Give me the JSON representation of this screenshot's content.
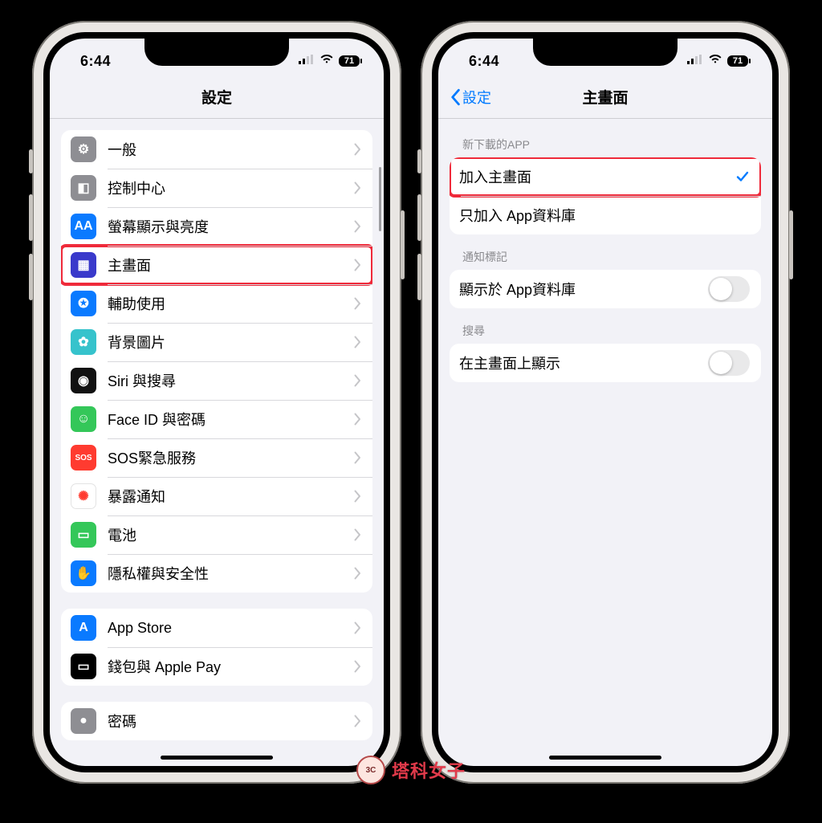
{
  "status": {
    "time": "6:44",
    "battery": "71"
  },
  "left": {
    "title": "設定",
    "group1": [
      {
        "label": "一般",
        "icon_bg": "#8e8e93",
        "glyph": "⚙"
      },
      {
        "label": "控制中心",
        "icon_bg": "#8e8e93",
        "glyph": "◧"
      },
      {
        "label": "螢幕顯示與亮度",
        "icon_bg": "#0a7aff",
        "glyph": "AA"
      },
      {
        "label": "主畫面",
        "icon_bg": "#3a3acb",
        "glyph": "▦",
        "highlight": true
      },
      {
        "label": "輔助使用",
        "icon_bg": "#0a7aff",
        "glyph": "✪"
      },
      {
        "label": "背景圖片",
        "icon_bg": "#36c3cc",
        "glyph": "✿"
      },
      {
        "label": "Siri 與搜尋",
        "icon_bg": "#111",
        "glyph": "◉"
      },
      {
        "label": "Face ID 與密碼",
        "icon_bg": "#34c759",
        "glyph": "☺"
      },
      {
        "label": "SOS緊急服務",
        "icon_bg": "#ff3b30",
        "glyph": "SOS"
      },
      {
        "label": "暴露通知",
        "icon_bg": "#ffffff",
        "glyph": "✺",
        "glyph_color": "#ff3b30",
        "border": true
      },
      {
        "label": "電池",
        "icon_bg": "#34c759",
        "glyph": "▭"
      },
      {
        "label": "隱私權與安全性",
        "icon_bg": "#0a7aff",
        "glyph": "✋"
      }
    ],
    "group2": [
      {
        "label": "App Store",
        "icon_bg": "#0a7aff",
        "glyph": "A"
      },
      {
        "label": "錢包與 Apple Pay",
        "icon_bg": "#000",
        "glyph": "▭"
      }
    ],
    "group3": [
      {
        "label": "密碼",
        "icon_bg": "#8e8e93",
        "glyph": "●"
      }
    ]
  },
  "right": {
    "back": "設定",
    "title": "主畫面",
    "sections": {
      "new_app_header": "新下載的APP",
      "add_home": "加入主畫面",
      "app_library_only": "只加入 App資料庫",
      "badge_header": "通知標記",
      "show_in_library": "顯示於 App資料庫",
      "search_header": "搜尋",
      "show_on_home": "在主畫面上顯示"
    }
  },
  "watermark": {
    "face": "3C",
    "text": "塔科女子"
  }
}
